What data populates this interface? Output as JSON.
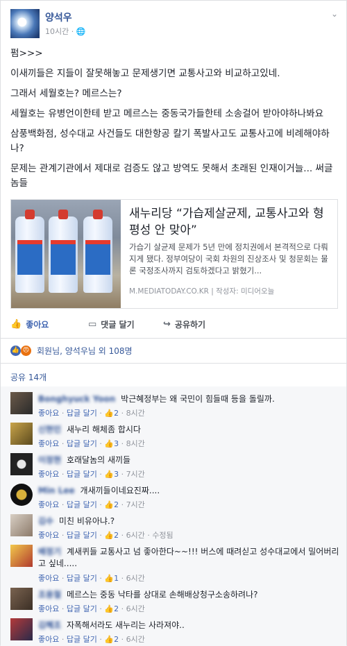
{
  "post": {
    "author": "양석우",
    "time": "10시간",
    "privacy_icon": "globe-icon",
    "paragraphs": [
      "펌>>>",
      "이새끼들은 지들이 잘못해놓고 문제생기면 교통사고와 비교하고있네.",
      "그래서 세월호는? 메르스는?",
      "세월호는 유병언이한테 받고 메르스는 중동국가들한테 소송걸어 받아야하나봐요",
      "삼풍백화점, 성수대교 사건들도 대한항공 칼기 폭발사고도 교통사고에 비례해야하나?",
      "문제는 관계기관에서 제대로 검증도 않고 방역도 못해서 초래된 인재이거늘... 써글놈들"
    ]
  },
  "link": {
    "title": "새누리당 “가습제살균제, 교통사고와 형평성 안 맞아”",
    "description": "가습기 살균제 문제가 5년 만에 정치권에서 본격적으로 다뤄지게 됐다. 정부여당이 국회 차원의 진상조사 및 청문회는 물론 국정조사까지 검토하겠다고 밝혔기...",
    "source": "M.MEDIATODAY.CO.KR | 작성자: 미디어오늘"
  },
  "actions": {
    "like": "좋아요",
    "comment": "댓글 달기",
    "share": "공유하기"
  },
  "reactions": {
    "text": "회원님, 양석우님 외 108명"
  },
  "shares": "공유 14개",
  "comment_actions": {
    "like": "좋아요",
    "reply": "답글 달기",
    "sep": "·"
  },
  "comments": [
    {
      "name": "Bonghyuck Yoon",
      "text": "박근혜정부는 왜 국민이 힘들때 등을 돌릴까.",
      "likes": "2",
      "time": "8시간",
      "edited": ""
    },
    {
      "name": "신현민",
      "text": "새누리 해체좀 합시다",
      "likes": "3",
      "time": "8시간",
      "edited": ""
    },
    {
      "name": "이정현",
      "text": "호래달놈의 새끼들",
      "likes": "3",
      "time": "7시간",
      "edited": ""
    },
    {
      "name": "Min Lee",
      "text": "개새끼들이네요진짜....",
      "likes": "2",
      "time": "7시간",
      "edited": ""
    },
    {
      "name": "김수",
      "text": "미친 비유아냐.?",
      "likes": "2",
      "time": "6시간",
      "edited": "수정됨"
    },
    {
      "name": "배정기",
      "text": "계새퀴들 교통사고 넘 좋아한다~~!!! 버스에 때려싣고 성수대교에서 밀어버리고 싶네.....",
      "likes": "1",
      "time": "6시간",
      "edited": ""
    },
    {
      "name": "조용철",
      "text": "메르스는 중동 낙타를 상대로 손해배상청구소송하려나?",
      "likes": "2",
      "time": "6시간",
      "edited": ""
    },
    {
      "name": "김혜조",
      "text": "자폭해서라도 새누리는 사라져야..",
      "likes": "2",
      "time": "6시간",
      "edited": ""
    }
  ],
  "colors": {
    "link_blue": "#365899",
    "like_blue": "#4267b2",
    "meta_gray": "#90949c",
    "comment_bg": "#f6f7f9"
  }
}
